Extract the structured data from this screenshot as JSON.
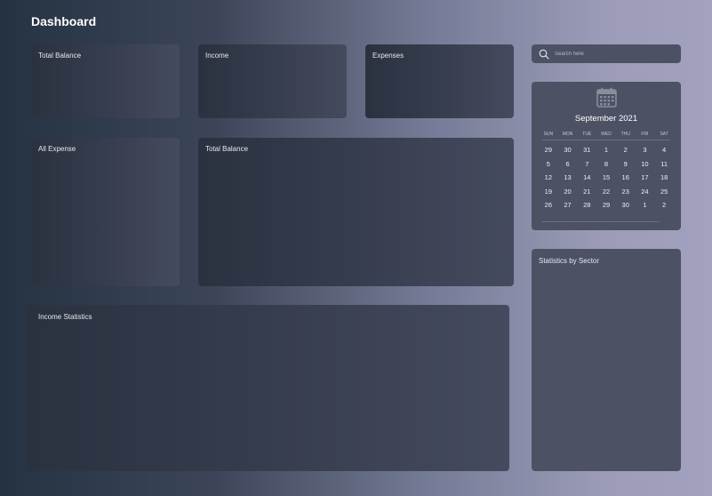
{
  "header": {
    "title": "Dashboard"
  },
  "cards": {
    "total_balance_top": "Total Balance",
    "income": "Income",
    "expenses": "Expenses",
    "all_expense": "All Expense",
    "total_balance_main": "Total Balance",
    "income_statistics": "Income Statistics"
  },
  "search": {
    "placeholder": "Search here",
    "icon": "search-icon"
  },
  "calendar": {
    "icon": "calendar-icon",
    "month_label": "September 2021",
    "weekdays": [
      "SUN",
      "MON",
      "TUE",
      "WED",
      "THU",
      "FRI",
      "SAT"
    ],
    "weeks": [
      [
        "29",
        "30",
        "31",
        "1",
        "2",
        "3",
        "4"
      ],
      [
        "5",
        "6",
        "7",
        "8",
        "9",
        "10",
        "11"
      ],
      [
        "12",
        "13",
        "14",
        "15",
        "16",
        "17",
        "18"
      ],
      [
        "19",
        "20",
        "21",
        "22",
        "23",
        "24",
        "25"
      ],
      [
        "26",
        "27",
        "28",
        "29",
        "30",
        "1",
        "2"
      ]
    ]
  },
  "statistics": {
    "label": "Statistics by Sector"
  }
}
